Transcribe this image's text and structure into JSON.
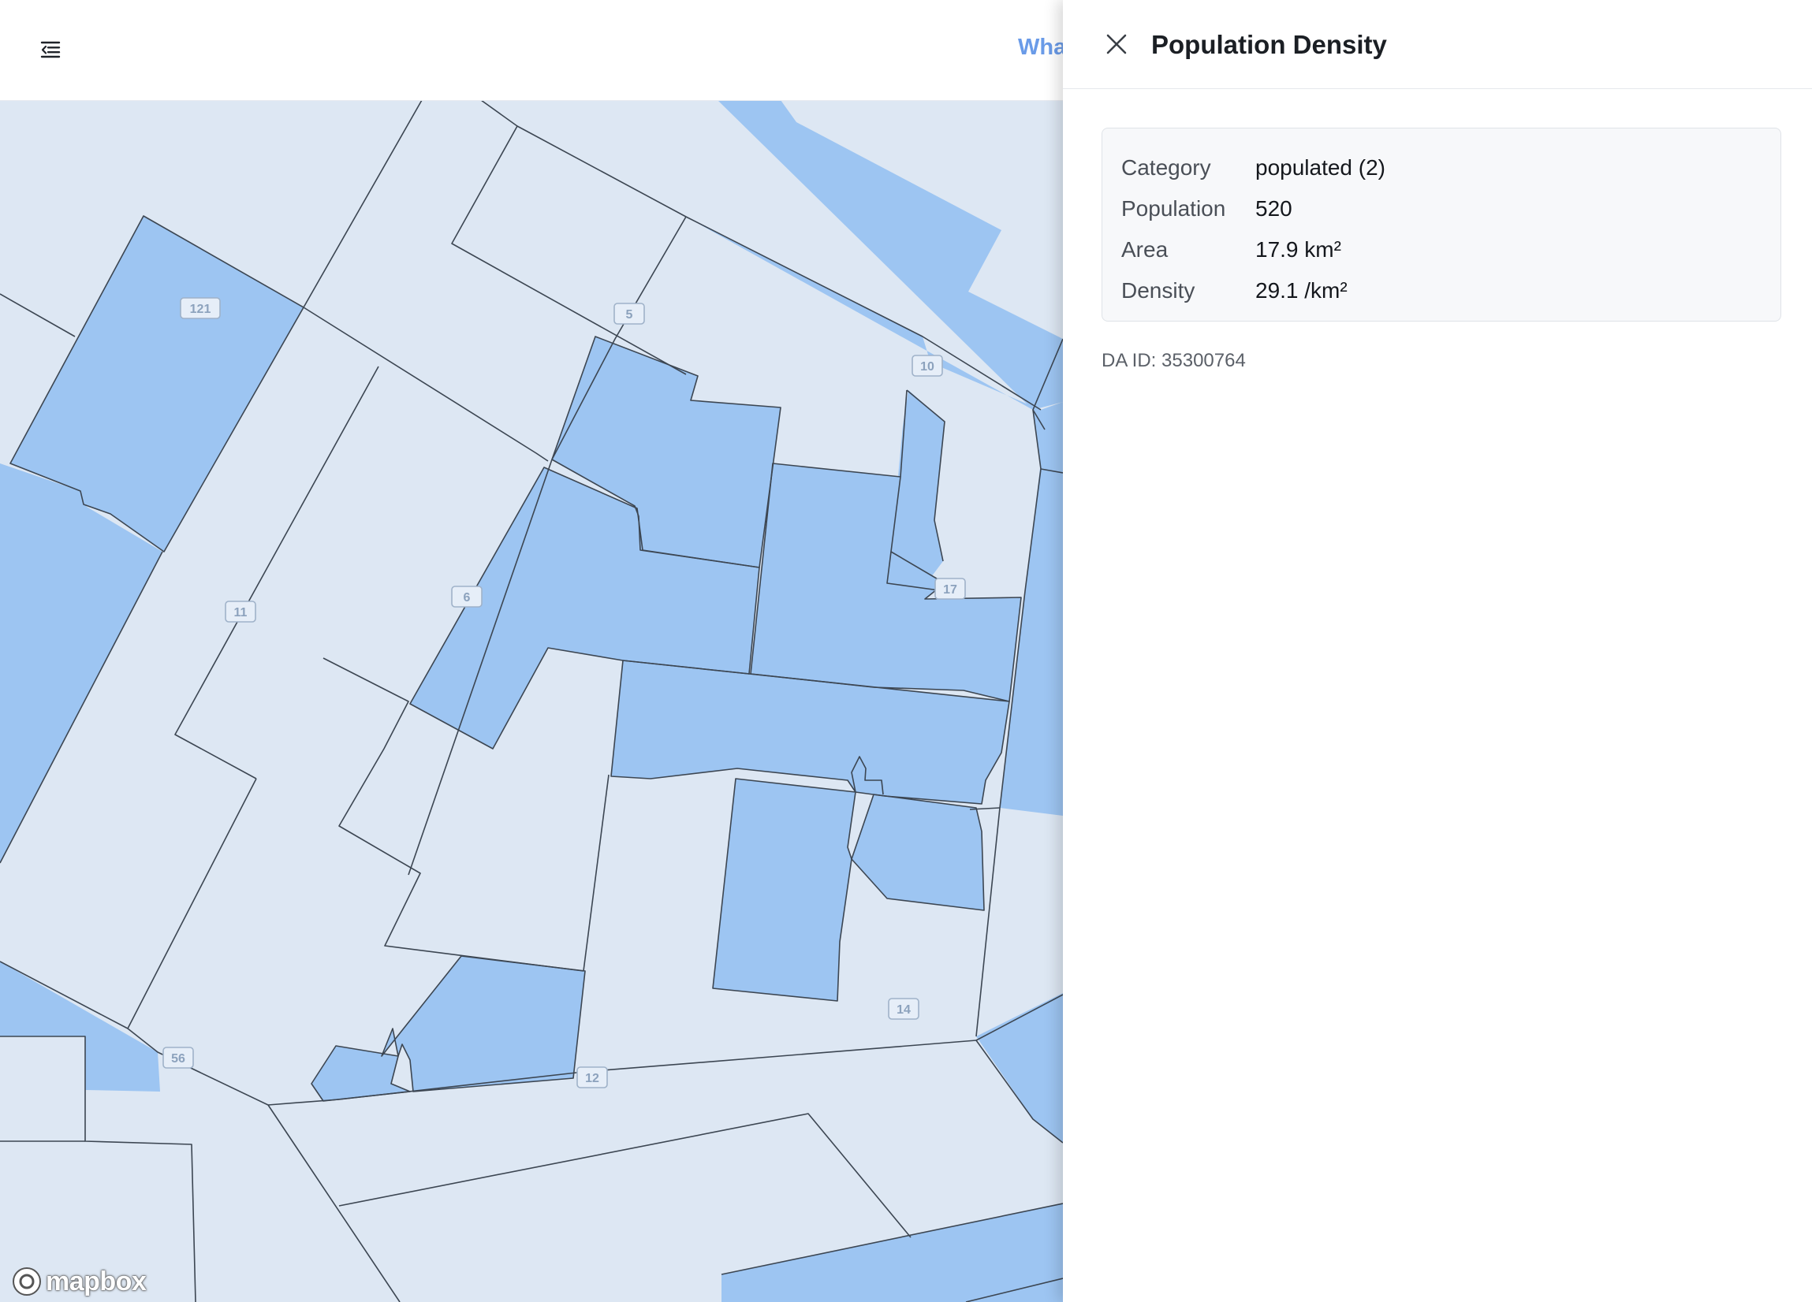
{
  "header": {
    "menu_icon": "indent-menu-icon",
    "link_text": "Wha",
    "link_color": "#6a9be8"
  },
  "map": {
    "attribution_logo": "mapbox",
    "colors": {
      "populated": "#9dc5f2",
      "other": "#dde7f3",
      "border": "#3c4652"
    },
    "road_labels": [
      "121",
      "5",
      "10",
      "11",
      "6",
      "17",
      "14",
      "56",
      "12"
    ]
  },
  "panel": {
    "close_icon": "close-icon",
    "title": "Population Density",
    "stats": [
      {
        "label": "Category",
        "value": "populated (2)"
      },
      {
        "label": "Population",
        "value": "520"
      },
      {
        "label": "Area",
        "value": "17.9 km²"
      },
      {
        "label": "Density",
        "value": "29.1 /km²"
      }
    ],
    "da_id": "DA ID: 35300764"
  }
}
